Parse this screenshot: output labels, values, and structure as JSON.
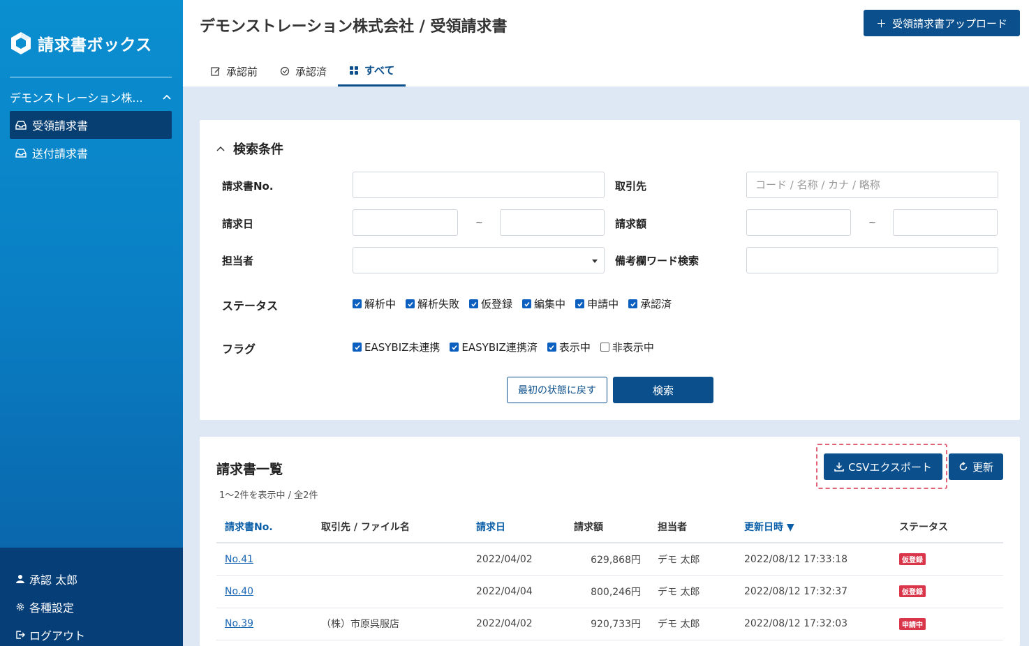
{
  "brand": {
    "name": "請求書ボックス"
  },
  "sidebar": {
    "company": "デモンストレーション株...",
    "items": [
      {
        "label": "受領請求書",
        "active": true
      },
      {
        "label": "送付請求書",
        "active": false
      }
    ],
    "bottom": {
      "user": "承認 太郎",
      "settings": "各種設定",
      "logout": "ログアウト"
    }
  },
  "header": {
    "title": "デモンストレーション株式会社 / 受領請求書",
    "upload_label": "受領請求書アップロード",
    "tabs": [
      {
        "label": "承認前",
        "icon": "edit-icon"
      },
      {
        "label": "承認済",
        "icon": "check-circle-icon"
      },
      {
        "label": "すべて",
        "icon": "grid-icon",
        "active": true
      }
    ]
  },
  "search": {
    "heading": "検索条件",
    "invoice_no_label": "請求書No.",
    "partner_label": "取引先",
    "partner_placeholder": "コード / 名称 / カナ / 略称",
    "date_label": "請求日",
    "amount_label": "請求額",
    "tilde": "~",
    "person_label": "担当者",
    "memo_label": "備考欄ワード検索",
    "status_label": "ステータス",
    "status_options": [
      {
        "label": "解析中",
        "checked": true
      },
      {
        "label": "解析失敗",
        "checked": true
      },
      {
        "label": "仮登録",
        "checked": true
      },
      {
        "label": "編集中",
        "checked": true
      },
      {
        "label": "申請中",
        "checked": true
      },
      {
        "label": "承認済",
        "checked": true
      }
    ],
    "flag_label": "フラグ",
    "flag_options": [
      {
        "label": "EASYBIZ未連携",
        "checked": true
      },
      {
        "label": "EASYBIZ連携済",
        "checked": true
      },
      {
        "label": "表示中",
        "checked": true
      },
      {
        "label": "非表示中",
        "checked": false
      }
    ],
    "reset_label": "最初の状態に戻す",
    "search_label": "検索"
  },
  "list": {
    "title": "請求書一覧",
    "count": "1〜2件を表示中 / 全2件",
    "csv_label": "CSVエクスポート",
    "refresh_label": "更新",
    "columns": [
      "請求書No.",
      "取引先 / ファイル名",
      "請求日",
      "請求額",
      "担当者",
      "更新日時 ▼",
      "ステータス"
    ],
    "rows": [
      {
        "no": "No.41",
        "partner": "",
        "date": "2022/04/02",
        "amount": "629,868円",
        "person": "デモ 太郎",
        "updated": "2022/08/12 17:33:18",
        "status": "仮登録"
      },
      {
        "no": "No.40",
        "partner": "",
        "date": "2022/04/04",
        "amount": "800,246円",
        "person": "デモ 太郎",
        "updated": "2022/08/12 17:32:37",
        "status": "仮登録"
      },
      {
        "no": "No.39",
        "partner": "（株）市原呉服店",
        "date": "2022/04/02",
        "amount": "920,733円",
        "person": "デモ 太郎",
        "updated": "2022/08/12 17:32:03",
        "status": "申請中"
      }
    ]
  },
  "colors": {
    "primary": "#0b4f8c",
    "sidebar_top": "#0a8fd0",
    "badge": "#d9364a",
    "highlight": "#e06377"
  }
}
